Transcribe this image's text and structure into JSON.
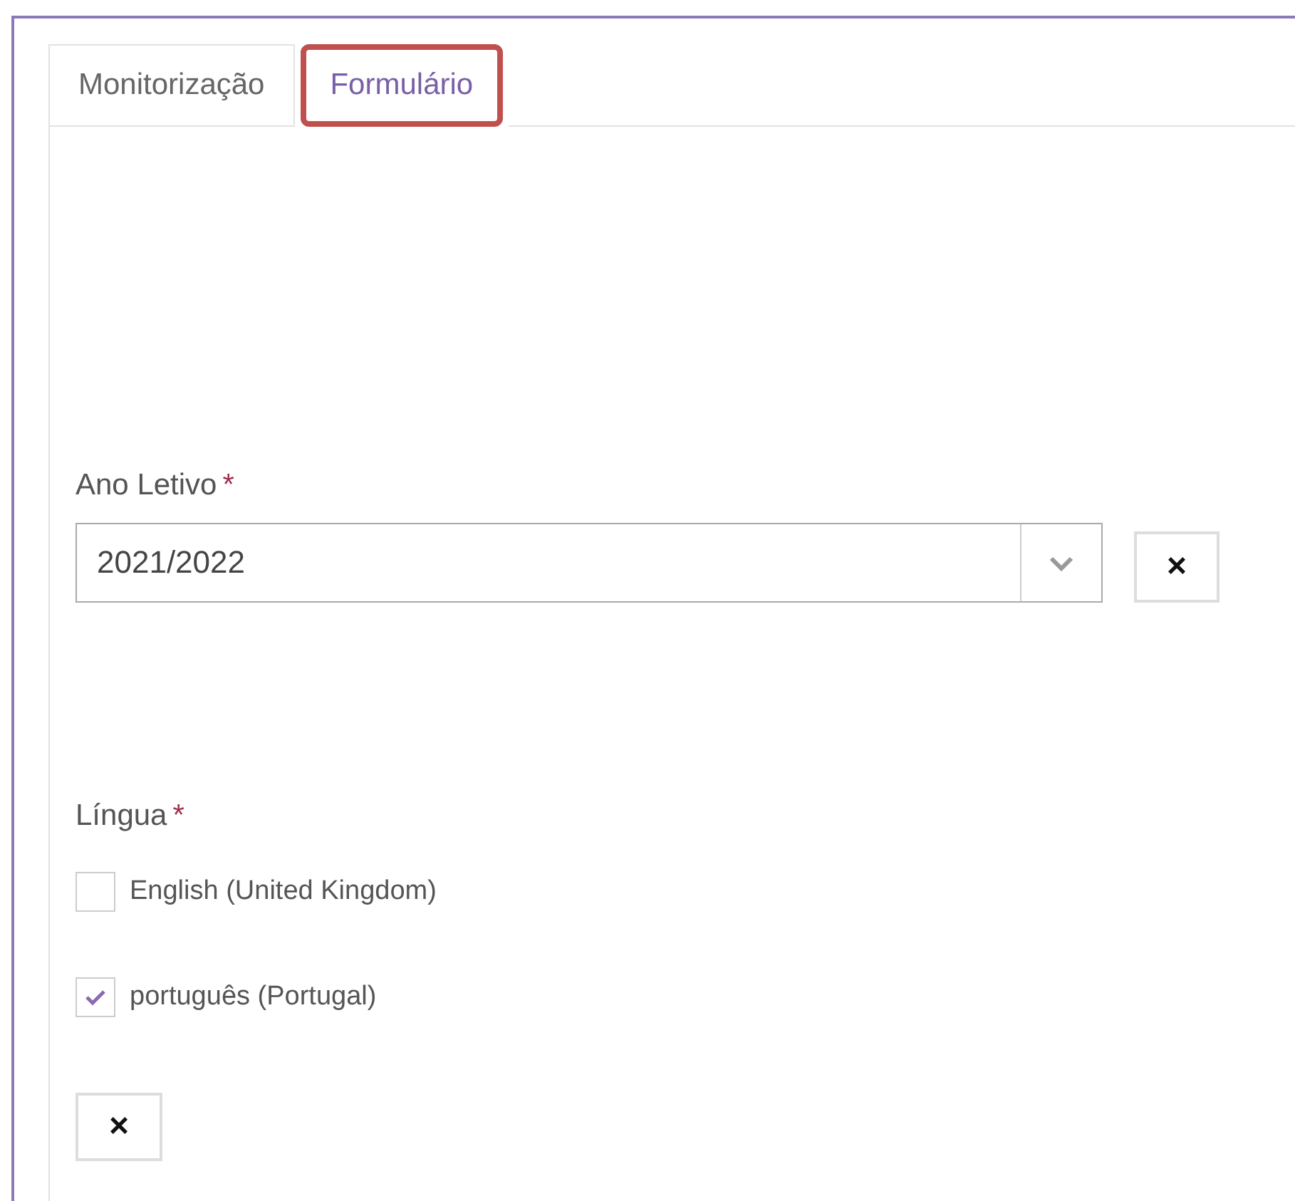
{
  "tabs": [
    {
      "label": "Monitorização",
      "selected": false,
      "highlighted": false
    },
    {
      "label": "Formulário",
      "selected": true,
      "highlighted": true
    }
  ],
  "ano_letivo": {
    "label": "Ano Letivo",
    "required_mark": "*",
    "value": "2021/2022",
    "clear": "×"
  },
  "lingua": {
    "label": "Língua",
    "required_mark": "*",
    "options": [
      {
        "label": "English (United Kingdom)",
        "checked": false
      },
      {
        "label": "português (Portugal)",
        "checked": true
      }
    ],
    "clear": "×"
  }
}
